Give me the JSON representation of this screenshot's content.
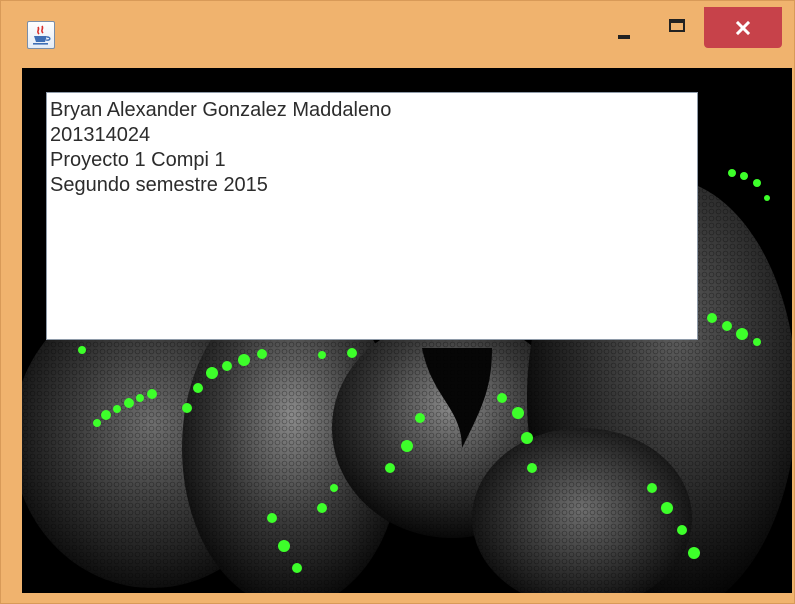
{
  "window": {
    "app_icon": "java-coffee-cup-icon",
    "controls": {
      "minimize_icon": "minimize-icon",
      "maximize_icon": "maximize-icon",
      "close_icon": "close-icon"
    },
    "colors": {
      "frame": "#f0b36e",
      "close_button": "#c7424a",
      "background": "#000000",
      "snake_accent": "#3dff2a"
    }
  },
  "text_area": {
    "lines": [
      "Bryan Alexander Gonzalez Maddaleno",
      "201314024",
      "Proyecto 1 Compi 1",
      "Segundo semestre 2015"
    ]
  }
}
